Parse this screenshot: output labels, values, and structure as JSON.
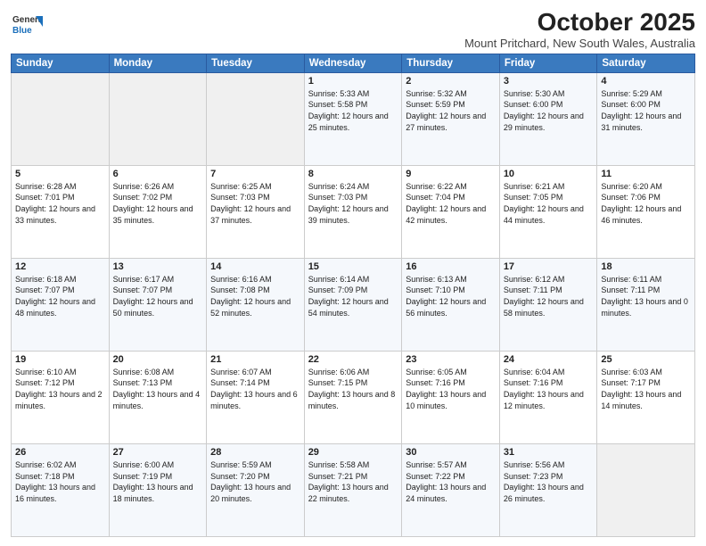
{
  "logo": {
    "line1": "General",
    "line2": "Blue"
  },
  "title": "October 2025",
  "location": "Mount Pritchard, New South Wales, Australia",
  "weekdays": [
    "Sunday",
    "Monday",
    "Tuesday",
    "Wednesday",
    "Thursday",
    "Friday",
    "Saturday"
  ],
  "rows": [
    [
      {
        "day": "",
        "sunrise": "",
        "sunset": "",
        "daylight": ""
      },
      {
        "day": "",
        "sunrise": "",
        "sunset": "",
        "daylight": ""
      },
      {
        "day": "",
        "sunrise": "",
        "sunset": "",
        "daylight": ""
      },
      {
        "day": "1",
        "sunrise": "Sunrise: 5:33 AM",
        "sunset": "Sunset: 5:58 PM",
        "daylight": "Daylight: 12 hours and 25 minutes."
      },
      {
        "day": "2",
        "sunrise": "Sunrise: 5:32 AM",
        "sunset": "Sunset: 5:59 PM",
        "daylight": "Daylight: 12 hours and 27 minutes."
      },
      {
        "day": "3",
        "sunrise": "Sunrise: 5:30 AM",
        "sunset": "Sunset: 6:00 PM",
        "daylight": "Daylight: 12 hours and 29 minutes."
      },
      {
        "day": "4",
        "sunrise": "Sunrise: 5:29 AM",
        "sunset": "Sunset: 6:00 PM",
        "daylight": "Daylight: 12 hours and 31 minutes."
      }
    ],
    [
      {
        "day": "5",
        "sunrise": "Sunrise: 6:28 AM",
        "sunset": "Sunset: 7:01 PM",
        "daylight": "Daylight: 12 hours and 33 minutes."
      },
      {
        "day": "6",
        "sunrise": "Sunrise: 6:26 AM",
        "sunset": "Sunset: 7:02 PM",
        "daylight": "Daylight: 12 hours and 35 minutes."
      },
      {
        "day": "7",
        "sunrise": "Sunrise: 6:25 AM",
        "sunset": "Sunset: 7:03 PM",
        "daylight": "Daylight: 12 hours and 37 minutes."
      },
      {
        "day": "8",
        "sunrise": "Sunrise: 6:24 AM",
        "sunset": "Sunset: 7:03 PM",
        "daylight": "Daylight: 12 hours and 39 minutes."
      },
      {
        "day": "9",
        "sunrise": "Sunrise: 6:22 AM",
        "sunset": "Sunset: 7:04 PM",
        "daylight": "Daylight: 12 hours and 42 minutes."
      },
      {
        "day": "10",
        "sunrise": "Sunrise: 6:21 AM",
        "sunset": "Sunset: 7:05 PM",
        "daylight": "Daylight: 12 hours and 44 minutes."
      },
      {
        "day": "11",
        "sunrise": "Sunrise: 6:20 AM",
        "sunset": "Sunset: 7:06 PM",
        "daylight": "Daylight: 12 hours and 46 minutes."
      }
    ],
    [
      {
        "day": "12",
        "sunrise": "Sunrise: 6:18 AM",
        "sunset": "Sunset: 7:07 PM",
        "daylight": "Daylight: 12 hours and 48 minutes."
      },
      {
        "day": "13",
        "sunrise": "Sunrise: 6:17 AM",
        "sunset": "Sunset: 7:07 PM",
        "daylight": "Daylight: 12 hours and 50 minutes."
      },
      {
        "day": "14",
        "sunrise": "Sunrise: 6:16 AM",
        "sunset": "Sunset: 7:08 PM",
        "daylight": "Daylight: 12 hours and 52 minutes."
      },
      {
        "day": "15",
        "sunrise": "Sunrise: 6:14 AM",
        "sunset": "Sunset: 7:09 PM",
        "daylight": "Daylight: 12 hours and 54 minutes."
      },
      {
        "day": "16",
        "sunrise": "Sunrise: 6:13 AM",
        "sunset": "Sunset: 7:10 PM",
        "daylight": "Daylight: 12 hours and 56 minutes."
      },
      {
        "day": "17",
        "sunrise": "Sunrise: 6:12 AM",
        "sunset": "Sunset: 7:11 PM",
        "daylight": "Daylight: 12 hours and 58 minutes."
      },
      {
        "day": "18",
        "sunrise": "Sunrise: 6:11 AM",
        "sunset": "Sunset: 7:11 PM",
        "daylight": "Daylight: 13 hours and 0 minutes."
      }
    ],
    [
      {
        "day": "19",
        "sunrise": "Sunrise: 6:10 AM",
        "sunset": "Sunset: 7:12 PM",
        "daylight": "Daylight: 13 hours and 2 minutes."
      },
      {
        "day": "20",
        "sunrise": "Sunrise: 6:08 AM",
        "sunset": "Sunset: 7:13 PM",
        "daylight": "Daylight: 13 hours and 4 minutes."
      },
      {
        "day": "21",
        "sunrise": "Sunrise: 6:07 AM",
        "sunset": "Sunset: 7:14 PM",
        "daylight": "Daylight: 13 hours and 6 minutes."
      },
      {
        "day": "22",
        "sunrise": "Sunrise: 6:06 AM",
        "sunset": "Sunset: 7:15 PM",
        "daylight": "Daylight: 13 hours and 8 minutes."
      },
      {
        "day": "23",
        "sunrise": "Sunrise: 6:05 AM",
        "sunset": "Sunset: 7:16 PM",
        "daylight": "Daylight: 13 hours and 10 minutes."
      },
      {
        "day": "24",
        "sunrise": "Sunrise: 6:04 AM",
        "sunset": "Sunset: 7:16 PM",
        "daylight": "Daylight: 13 hours and 12 minutes."
      },
      {
        "day": "25",
        "sunrise": "Sunrise: 6:03 AM",
        "sunset": "Sunset: 7:17 PM",
        "daylight": "Daylight: 13 hours and 14 minutes."
      }
    ],
    [
      {
        "day": "26",
        "sunrise": "Sunrise: 6:02 AM",
        "sunset": "Sunset: 7:18 PM",
        "daylight": "Daylight: 13 hours and 16 minutes."
      },
      {
        "day": "27",
        "sunrise": "Sunrise: 6:00 AM",
        "sunset": "Sunset: 7:19 PM",
        "daylight": "Daylight: 13 hours and 18 minutes."
      },
      {
        "day": "28",
        "sunrise": "Sunrise: 5:59 AM",
        "sunset": "Sunset: 7:20 PM",
        "daylight": "Daylight: 13 hours and 20 minutes."
      },
      {
        "day": "29",
        "sunrise": "Sunrise: 5:58 AM",
        "sunset": "Sunset: 7:21 PM",
        "daylight": "Daylight: 13 hours and 22 minutes."
      },
      {
        "day": "30",
        "sunrise": "Sunrise: 5:57 AM",
        "sunset": "Sunset: 7:22 PM",
        "daylight": "Daylight: 13 hours and 24 minutes."
      },
      {
        "day": "31",
        "sunrise": "Sunrise: 5:56 AM",
        "sunset": "Sunset: 7:23 PM",
        "daylight": "Daylight: 13 hours and 26 minutes."
      },
      {
        "day": "",
        "sunrise": "",
        "sunset": "",
        "daylight": ""
      }
    ]
  ]
}
